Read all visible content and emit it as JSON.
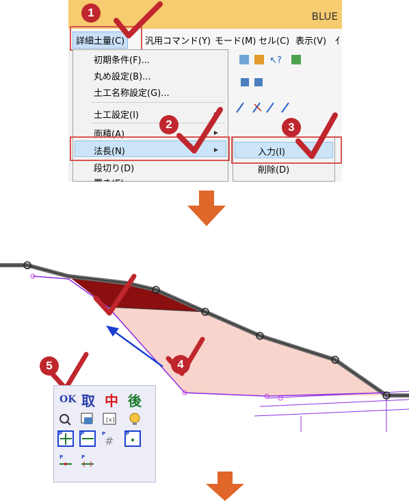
{
  "app": {
    "title_fragment": "BLUE"
  },
  "menubar": {
    "items": [
      "詳細土量(C)",
      "汎用コマンド(Y)",
      "モード(M)",
      "セル(C)",
      "表示(V)",
      "亻"
    ]
  },
  "dropdown": {
    "items": [
      {
        "label": "初期条件(F)...",
        "has_submenu": false
      },
      {
        "label": "丸め設定(B)...",
        "has_submenu": false
      },
      {
        "label": "土工名称設定(G)...",
        "has_submenu": false
      },
      {
        "label": "土工設定(I)",
        "has_submenu": true
      },
      {
        "label": "面積(A)",
        "has_submenu": true
      },
      {
        "label": "法長(N)",
        "has_submenu": true,
        "highlighted": true
      },
      {
        "label": "段切り(D)",
        "has_submenu": false
      },
      {
        "label": "置き(E)",
        "has_submenu": false
      }
    ]
  },
  "submenu": {
    "items": [
      {
        "label": "入力(I)",
        "highlighted": true
      },
      {
        "label": "削除(D)",
        "highlighted": false
      }
    ]
  },
  "steps": [
    "1",
    "2",
    "3",
    "4",
    "5"
  ],
  "palette": {
    "row1": [
      "OK",
      "取",
      "中",
      "後"
    ],
    "row1_colors": [
      "#2b3ea8",
      "#2b3ea8",
      "#d81b1b",
      "#1c7a2d"
    ]
  },
  "colors": {
    "badge": "#c0262d",
    "check": "#c0262d",
    "arrow": "#e0662a",
    "cut_fill": "#8b0f0f",
    "fill_area": "#f8d4cc",
    "line_purple": "#8a2be2",
    "blue_arrow": "#1a3fd1",
    "titlebar": "#f7cb6f"
  }
}
